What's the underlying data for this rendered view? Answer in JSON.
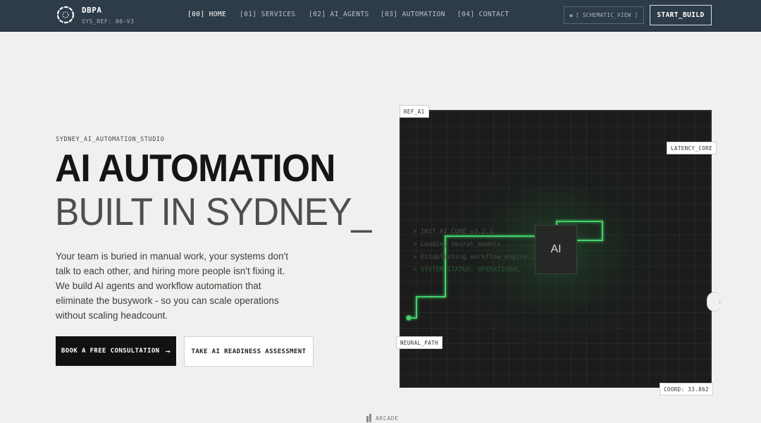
{
  "nav": {
    "brand_name": "DBPA",
    "brand_ref": "SYS_REF: 00-V3",
    "links": [
      {
        "label": "[00] HOME"
      },
      {
        "label": "[01] SERVICES"
      },
      {
        "label": "[02] AI_AGENTS"
      },
      {
        "label": "[03] AUTOMATION"
      },
      {
        "label": "[04] CONTACT"
      }
    ],
    "active_index": 0,
    "schematic_label": "[ SCHEMATIC_VIEW ]",
    "schematic_icon": "dot-icon",
    "start_label": "START_BUILD"
  },
  "hero": {
    "eyebrow": "SYDNEY_AI_AUTOMATION_STUDIO",
    "headline_line1": "AI AUTOMATION",
    "headline_line2": "BUILT IN SYDNEY_",
    "description": "Your team is buried in manual work, your systems don't talk to each other, and hiring more people isn't fixing it. We build AI agents and workflow automation that eliminate the busywork - so you can scale operations without scaling headcount.",
    "cta_primary": "BOOK A FREE CONSULTATION",
    "cta_primary_icon": "arrow-right-icon",
    "cta_secondary": "TAKE AI READINESS ASSESSMENT"
  },
  "schematic": {
    "tag_ref": "REF_A1",
    "tag_latency": "LATENCY_CORE",
    "tag_neural": "NEURAL_PATH",
    "tag_coord": "COORD: 33.862",
    "log_lines": [
      "> INIT AI_CORE v3.2.1",
      "> Loading neural_models..........",
      "> Establishing workflow_engine...",
      "> SYSTEM STATUS: OPERATIONAL"
    ],
    "core_label": "AI",
    "accent_color": "#3fd46a",
    "panel_color": "#1b1c1b"
  },
  "footer": {
    "badge_label": "ARCADE",
    "badge_icon": "arcade-icon"
  }
}
